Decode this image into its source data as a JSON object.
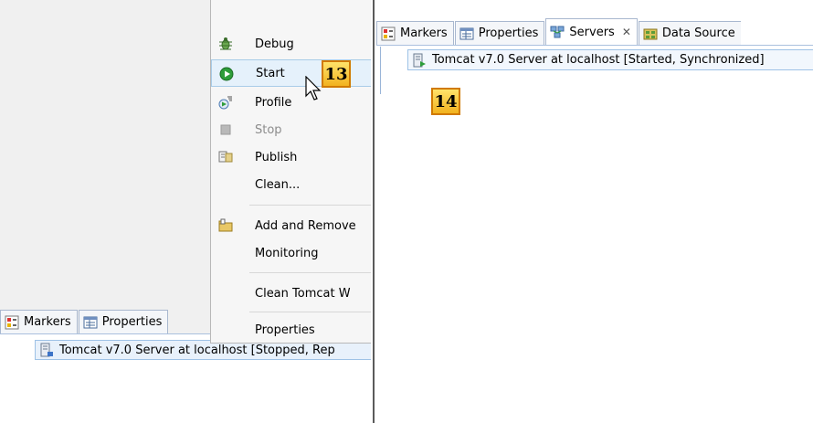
{
  "left_panel": {
    "tabs": [
      {
        "label": "Markers",
        "icon": "markers-icon"
      },
      {
        "label": "Properties",
        "icon": "properties-icon"
      }
    ],
    "server_row": {
      "label": "Tomcat v7.0 Server at localhost  [Stopped, Rep",
      "icon": "server-stopped-icon"
    },
    "context_menu": {
      "items": [
        {
          "label": "Debug",
          "icon": "debug-icon",
          "state": "normal"
        },
        {
          "label": "Start",
          "icon": "start-icon",
          "state": "highlighted"
        },
        {
          "label": "Profile",
          "icon": "profile-icon",
          "state": "normal"
        },
        {
          "label": "Stop",
          "icon": "stop-icon",
          "state": "disabled"
        },
        {
          "label": "Publish",
          "icon": "publish-icon",
          "state": "normal"
        },
        {
          "label": "Clean...",
          "icon": "",
          "state": "normal"
        },
        {
          "label": "Add and Remove",
          "icon": "add-remove-icon",
          "state": "normal"
        },
        {
          "label": "Monitoring",
          "icon": "",
          "state": "normal"
        },
        {
          "label": "Clean Tomcat W",
          "icon": "",
          "state": "normal"
        },
        {
          "label": "Properties",
          "icon": "",
          "state": "normal"
        }
      ]
    },
    "step_badge": "13"
  },
  "right_panel": {
    "tabs": [
      {
        "label": "Markers",
        "icon": "markers-icon"
      },
      {
        "label": "Properties",
        "icon": "properties-icon"
      },
      {
        "label": "Servers",
        "icon": "servers-icon",
        "active": true
      },
      {
        "label": "Data Source",
        "icon": "data-source-icon"
      }
    ],
    "server_row": {
      "label": "Tomcat v7.0 Server at localhost  [Started, Synchronized]",
      "icon": "server-started-icon"
    },
    "step_badge": "14"
  },
  "colors": {
    "selection": "#e5f1fb",
    "badge_fill": "#f2b21f",
    "badge_border": "#d07a00",
    "start_green": "#2e9d3a"
  }
}
